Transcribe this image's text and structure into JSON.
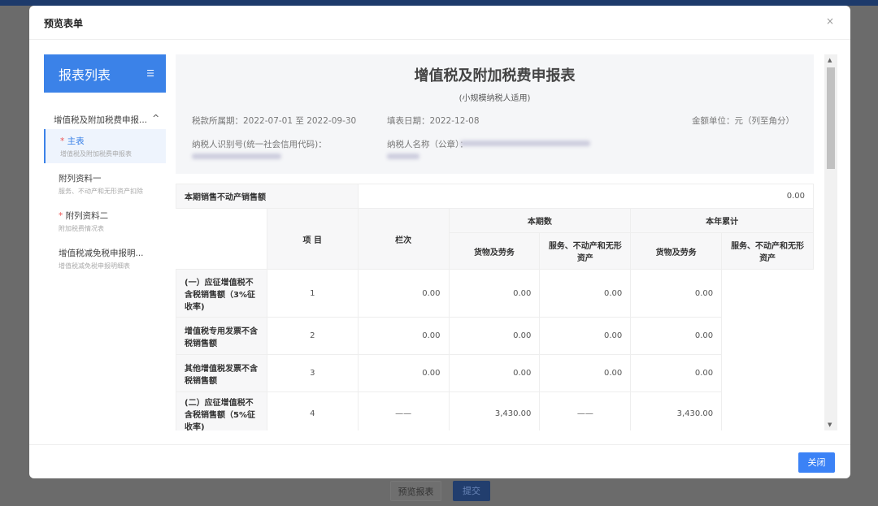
{
  "background": {
    "preview_button": "预览报表",
    "submit_button": "提交"
  },
  "modal": {
    "title": "预览表单",
    "close_icon": "×",
    "close_button": "关闭"
  },
  "sidebar": {
    "title": "报表列表",
    "menu_icon": "☰",
    "group": "增值税及附加税费申报...",
    "group_icon": "^",
    "items": [
      {
        "name": "主表",
        "sub": "增值税及附加税费申报表",
        "required": true,
        "active": true
      },
      {
        "name": "附列资料一",
        "sub": "服务、不动产和无形资产扣除",
        "required": false
      },
      {
        "name": "附列资料二",
        "sub": "附加税费情况表",
        "required": true
      },
      {
        "name": "增值税减免税申报明...",
        "sub": "增值税减免税申报明细表",
        "required": false
      }
    ]
  },
  "form": {
    "title": "增值税及附加税费申报表",
    "subtitle": "(小规模纳税人适用)",
    "period": "税款所属期：2022-07-01 至 2022-09-30",
    "fill_date": "填表日期：2022-12-08",
    "unit": "金额单位：元（列至角分）",
    "taxpayer_id_label": "纳税人识别号(统一社会信用代码)：",
    "taxpayer_name_label": "纳税人名称（公章）："
  },
  "table": {
    "top_label": "本期销售不动产销售额",
    "top_value": "0.00",
    "h_item": "项 目",
    "h_col": "栏次",
    "h_current": "本期数",
    "h_ytd": "本年累计",
    "h_goods": "货物及劳务",
    "h_services": "服务、不动产和无形资产",
    "rows": [
      {
        "item": "(一）应征增值税不含税销售额（3%征收率)",
        "col": "1",
        "v": [
          "0.00",
          "0.00",
          "0.00",
          "0.00"
        ]
      },
      {
        "item": "增值税专用发票不含税销售额",
        "col": "2",
        "v": [
          "0.00",
          "0.00",
          "0.00",
          "0.00"
        ]
      },
      {
        "item": "其他增值税发票不含税销售额",
        "col": "3",
        "v": [
          "0.00",
          "0.00",
          "0.00",
          "0.00"
        ]
      },
      {
        "item": "(二）应征增值税不含税销售额（5%征收率)",
        "col": "4",
        "v": [
          "——",
          "3,430.00",
          "——",
          "3,430.00"
        ]
      }
    ]
  }
}
